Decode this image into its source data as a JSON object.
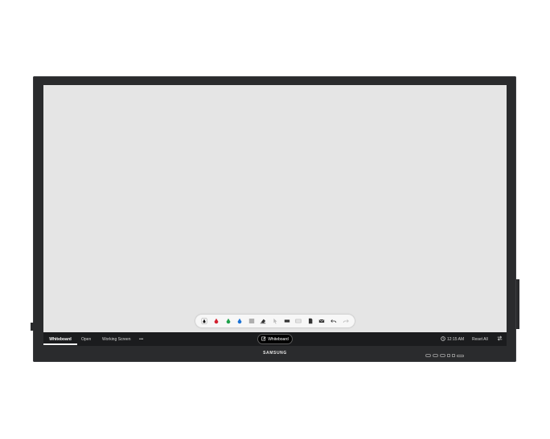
{
  "taskbar": {
    "tabs": [
      {
        "label": "Whiteboard"
      },
      {
        "label": "Open"
      },
      {
        "label": "Working Screen"
      }
    ],
    "more_label": "•••",
    "mode_button": {
      "label": "Whiteboard"
    },
    "time": "12:15 AM",
    "reset_label": "Reset All"
  },
  "brand": "SAMSUNG",
  "toolbar": {
    "tools": [
      {
        "name": "pen-black",
        "color": "#111111"
      },
      {
        "name": "pen-red",
        "color": "#d3202f"
      },
      {
        "name": "pen-green",
        "color": "#1ea14b"
      },
      {
        "name": "pen-blue",
        "color": "#1b73d6"
      },
      {
        "name": "menu-icon"
      },
      {
        "name": "eraser-icon"
      },
      {
        "name": "select-icon"
      },
      {
        "name": "keyboard-icon"
      },
      {
        "name": "grid-icon"
      },
      {
        "name": "document-icon"
      },
      {
        "name": "mail-icon"
      },
      {
        "name": "undo-icon"
      },
      {
        "name": "redo-icon"
      }
    ]
  }
}
